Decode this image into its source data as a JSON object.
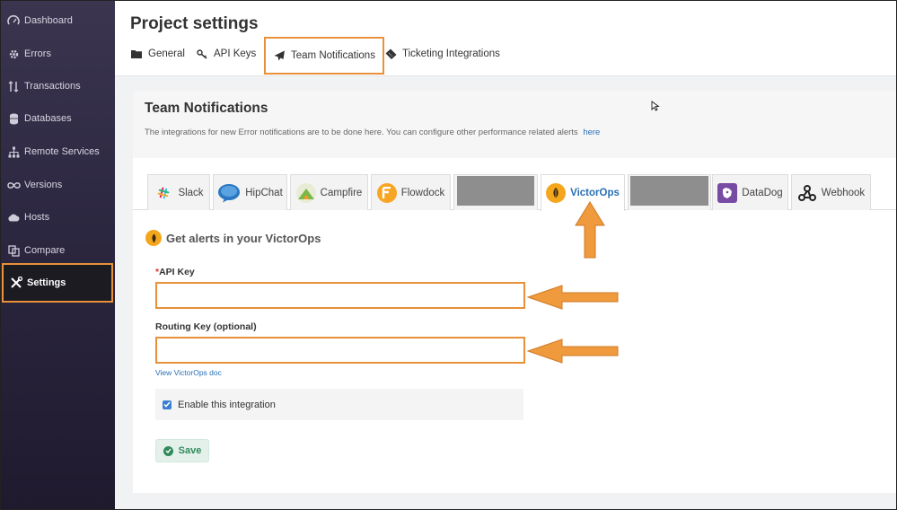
{
  "sidebar": {
    "items": [
      {
        "label": "Dashboard",
        "icon": "gauge-icon"
      },
      {
        "label": "Errors",
        "icon": "gear-bug-icon"
      },
      {
        "label": "Transactions",
        "icon": "transactions-icon"
      },
      {
        "label": "Databases",
        "icon": "database-icon"
      },
      {
        "label": "Remote Services",
        "icon": "sitemap-icon"
      },
      {
        "label": "Versions",
        "icon": "infinity-icon"
      },
      {
        "label": "Hosts",
        "icon": "cloud-icon"
      },
      {
        "label": "Compare",
        "icon": "compare-icon"
      },
      {
        "label": "Settings",
        "icon": "wrench-icon",
        "active": true
      }
    ]
  },
  "header": {
    "title": "Project settings",
    "tabs": [
      {
        "label": "General",
        "icon": "folder-icon"
      },
      {
        "label": "API Keys",
        "icon": "key-icon"
      },
      {
        "label": "Team Notifications",
        "icon": "paper-plane-icon",
        "active": true
      },
      {
        "label": "Ticketing Integrations",
        "icon": "ticket-icon"
      }
    ]
  },
  "card": {
    "title": "Team Notifications",
    "description": "The integrations for new Error notifications are to be done here. You can configure other performance related alerts",
    "description_link": "here"
  },
  "integrations": [
    {
      "label": "Slack",
      "icon": "slack-icon"
    },
    {
      "label": "HipChat",
      "icon": "hipchat-icon"
    },
    {
      "label": "Campfire",
      "icon": "campfire-icon"
    },
    {
      "label": "Flowdock",
      "icon": "flowdock-icon"
    },
    {
      "label": "",
      "icon": "",
      "redacted": true
    },
    {
      "label": "VictorOps",
      "icon": "victorops-icon",
      "active": true
    },
    {
      "label": "",
      "icon": "",
      "redacted": true
    },
    {
      "label": "DataDog",
      "icon": "datadog-icon"
    },
    {
      "label": "Webhook",
      "icon": "webhook-icon"
    }
  ],
  "form": {
    "heading": "Get alerts in your VictorOps",
    "api_key_label": "API Key",
    "api_key_required": "*",
    "api_key_value": "",
    "routing_key_label": "Routing Key (optional)",
    "routing_key_value": "",
    "doc_link": "View VictorOps doc",
    "enable_label": "Enable this integration",
    "enable_checked": true,
    "save_label": "Save"
  },
  "colors": {
    "highlight": "#e8903a",
    "sidebar_bg": "#2c2740",
    "link": "#2a6fb5",
    "save_green": "#2f8a5b"
  }
}
